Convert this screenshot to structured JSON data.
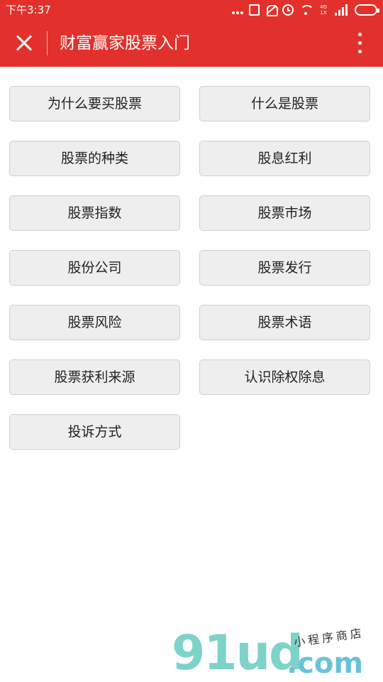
{
  "status": {
    "time": "下午3:37",
    "network": "4G 1X"
  },
  "header": {
    "title": "财富赢家股票入门"
  },
  "menu": {
    "items": [
      "为什么要买股票",
      "什么是股票",
      "股票的种类",
      "股息红利",
      "股票指数",
      "股票市场",
      "股份公司",
      "股票发行",
      "股票风险",
      "股票术语",
      "股票获利来源",
      "认识除权除息",
      "投诉方式"
    ]
  },
  "watermark": {
    "brand": "91ud",
    "domain": ".com",
    "tagline": "小程序商店"
  },
  "colors": {
    "accent": "#e2312c",
    "button_bg": "#eeeeee"
  }
}
